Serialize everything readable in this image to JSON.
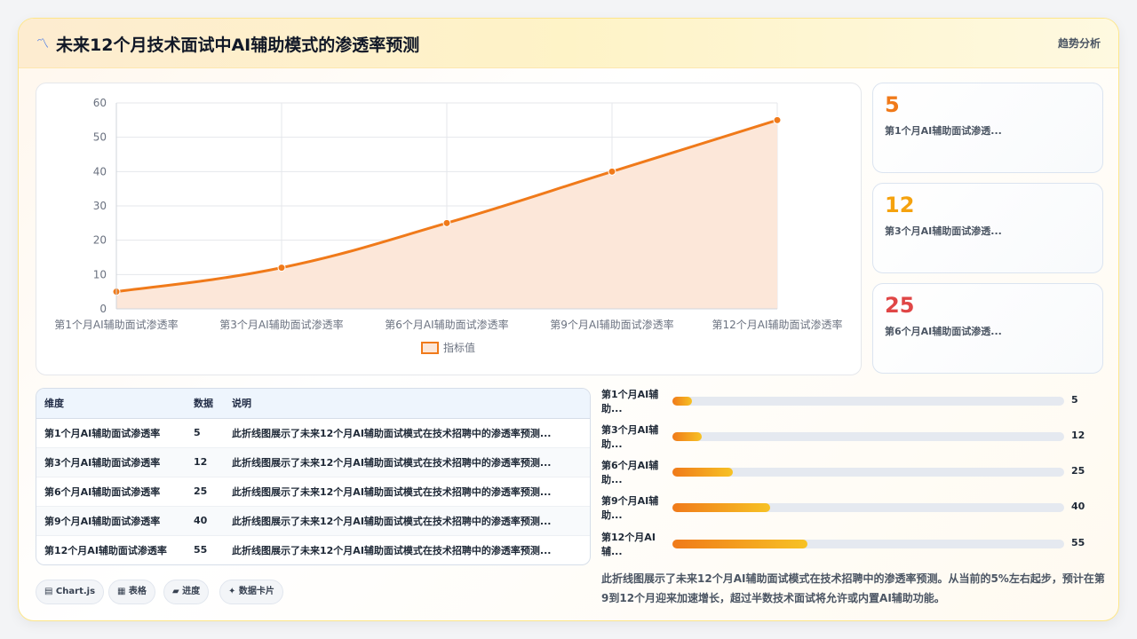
{
  "header": {
    "icon": "chart-line-icon",
    "title": "未来12个月技术面试中AI辅助模式的渗透率预测",
    "badge": "趋势分析"
  },
  "chart_data": {
    "type": "area",
    "categories": [
      "第1个月AI辅助面试渗透率",
      "第3个月AI辅助面试渗透率",
      "第6个月AI辅助面试渗透率",
      "第9个月AI辅助面试渗透率",
      "第12个月AI辅助面试渗透率"
    ],
    "series": [
      {
        "name": "指标值",
        "values": [
          5,
          12,
          25,
          40,
          55
        ],
        "color": "#f07a1a",
        "fill": "#fce7d9"
      }
    ],
    "ylim": [
      0,
      60
    ],
    "yticks": [
      "0",
      "10",
      "20",
      "30",
      "40",
      "50",
      "60"
    ],
    "grid": true,
    "legend": "bottom"
  },
  "stats": [
    {
      "value": "5",
      "label": "第1个月AI辅助面试渗透...",
      "color": "#f07a1a"
    },
    {
      "value": "12",
      "label": "第3个月AI辅助面试渗透...",
      "color": "#f5a20e"
    },
    {
      "value": "25",
      "label": "第6个月AI辅助面试渗透...",
      "color": "#e04646"
    }
  ],
  "table": {
    "headers": [
      "维度",
      "数据",
      "说明"
    ],
    "rows": [
      [
        "第1个月AI辅助面试渗透率",
        "5",
        "此折线图展示了未来12个月AI辅助面试模式在技术招聘中的渗透率预测..."
      ],
      [
        "第3个月AI辅助面试渗透率",
        "12",
        "此折线图展示了未来12个月AI辅助面试模式在技术招聘中的渗透率预测..."
      ],
      [
        "第6个月AI辅助面试渗透率",
        "25",
        "此折线图展示了未来12个月AI辅助面试模式在技术招聘中的渗透率预测..."
      ],
      [
        "第9个月AI辅助面试渗透率",
        "40",
        "此折线图展示了未来12个月AI辅助面试模式在技术招聘中的渗透率预测..."
      ],
      [
        "第12个月AI辅助面试渗透率",
        "55",
        "此折线图展示了未来12个月AI辅助面试模式在技术招聘中的渗透率预测..."
      ]
    ]
  },
  "bars": [
    {
      "label": "第1个月AI辅助...",
      "value": "5",
      "fraction": 0.05
    },
    {
      "label": "第3个月AI辅助...",
      "value": "12",
      "fraction": 0.075
    },
    {
      "label": "第6个月AI辅助...",
      "value": "25",
      "fraction": 0.155
    },
    {
      "label": "第9个月AI辅助...",
      "value": "40",
      "fraction": 0.25
    },
    {
      "label": "第12个月AI辅...",
      "value": "55",
      "fraction": 0.344
    }
  ],
  "chips": [
    {
      "icon": "database-icon",
      "label": "▤ Chart.js"
    },
    {
      "icon": "table-icon",
      "label": "▦ 表格"
    },
    {
      "icon": "progress-icon",
      "label": "▰ 进度"
    },
    {
      "icon": "sparkle-icon",
      "label": "✦ 数据卡片"
    }
  ],
  "description": "此折线图展示了未来12个月AI辅助面试模式在技术招聘中的渗透率预测。从当前的5%左右起步，预计在第9到12个月迎来加速增长，超过半数技术面试将允许或内置AI辅助功能。"
}
